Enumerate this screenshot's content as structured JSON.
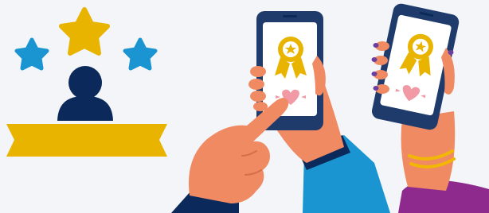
{
  "scene": {
    "background": "#f3f5f8",
    "colors": {
      "star_gold": "#e8b400",
      "star_blue": "#1b95d2",
      "avatar_navy": "#0b2a5b",
      "ribbon_gold": "#e8b400",
      "phone_body": "#1f3b6b",
      "phone_screen": "#ffffff",
      "skin": "#f08a63",
      "sleeve_blue": "#1b95d2",
      "sleeve_navy": "#0b2a5b",
      "sleeve_purple": "#8e2a8e",
      "heart_pink": "#f19aa6",
      "nail_purple": "#6b3fa0",
      "bracelet_gold": "#f2b705"
    },
    "icons": [
      "gold-star-icon",
      "blue-star-icon",
      "user-avatar-icon",
      "award-ribbon-badge-icon",
      "heart-icon",
      "pointing-hand-icon",
      "phone-icon"
    ]
  }
}
